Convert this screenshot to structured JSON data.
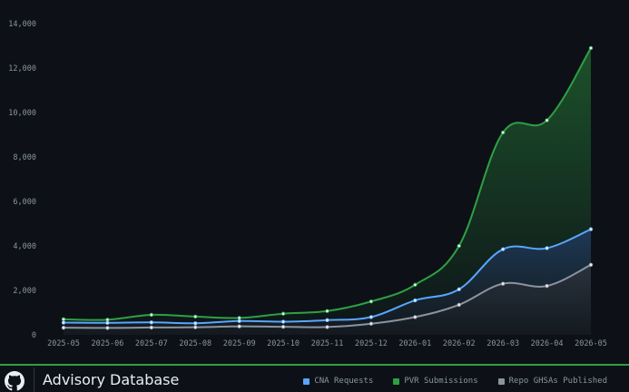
{
  "footer": {
    "brand": "Advisory Database",
    "logo_icon": "github-octocat-icon",
    "accent": "#2ea043"
  },
  "colors": {
    "background": "#0d1117",
    "grid": "#21262d",
    "axis_text": "#8b949e"
  },
  "chart_data": {
    "type": "area",
    "title": "",
    "xlabel": "",
    "ylabel": "",
    "ylim": [
      0,
      14000
    ],
    "yticks": [
      0,
      2000,
      4000,
      6000,
      8000,
      10000,
      12000,
      14000
    ],
    "ytick_labels": [
      "0",
      "2,000",
      "4,000",
      "6,000",
      "8,000",
      "10,000",
      "12,000",
      "14,000"
    ],
    "grid": "none",
    "legend_position": "bottom-right",
    "categories": [
      "2025-05",
      "2025-06",
      "2025-07",
      "2025-08",
      "2025-09",
      "2025-10",
      "2025-11",
      "2025-12",
      "2026-01",
      "2026-02",
      "2026-03",
      "2026-04",
      "2026-05"
    ],
    "series": [
      {
        "name": "PVR Submissions",
        "color": "#2ea043",
        "values": [
          700,
          680,
          900,
          820,
          760,
          950,
          1070,
          1500,
          2250,
          4000,
          9100,
          9650,
          12900
        ]
      },
      {
        "name": "CNA Requests",
        "color": "#58a6ff",
        "values": [
          550,
          540,
          560,
          520,
          620,
          590,
          660,
          800,
          1550,
          2050,
          3850,
          3900,
          4750
        ]
      },
      {
        "name": "Repo GHSAs Published",
        "color": "#8b949e",
        "values": [
          320,
          310,
          330,
          340,
          380,
          360,
          350,
          500,
          800,
          1350,
          2300,
          2200,
          3150
        ]
      }
    ],
    "legend_order": [
      "CNA Requests",
      "PVR Submissions",
      "Repo GHSAs Published"
    ]
  }
}
